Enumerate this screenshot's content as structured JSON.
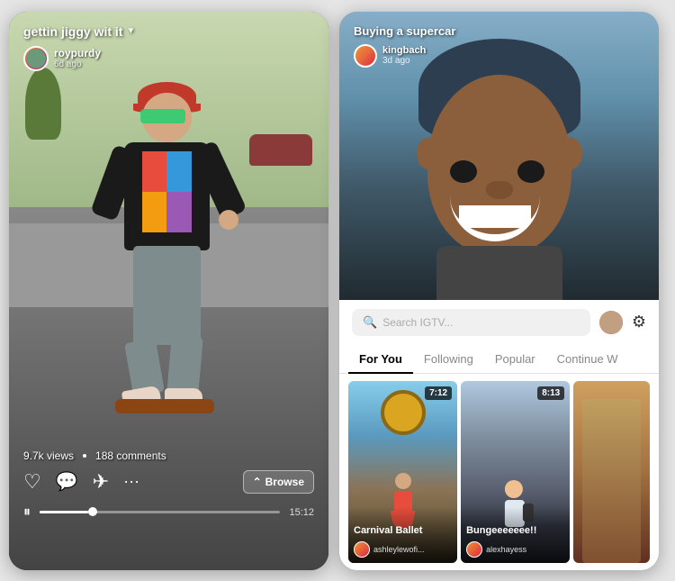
{
  "left_phone": {
    "title": "gettin jiggy wit it",
    "title_chevron": "▼",
    "creator": {
      "name": "roypurdy",
      "time": "6d ago"
    },
    "stats": {
      "views": "9.7k views",
      "comments": "188 comments"
    },
    "actions": {
      "browse_label": "Browse"
    },
    "progress": {
      "time": "15:12"
    }
  },
  "right_phone": {
    "video_title": "Buying a supercar",
    "creator": {
      "name": "kingbach",
      "time": "3d ago"
    },
    "search_placeholder": "Search IGTV...",
    "tabs": [
      {
        "label": "For You",
        "active": true
      },
      {
        "label": "Following",
        "active": false
      },
      {
        "label": "Popular",
        "active": false
      },
      {
        "label": "Continue W",
        "active": false
      }
    ],
    "thumbnails": [
      {
        "title": "Carnival Ballet",
        "creator": "ashleylewofi...",
        "duration": "7:12"
      },
      {
        "title": "Bungeeeeeee!!",
        "creator": "alexhayess",
        "duration": "8:13"
      },
      {
        "title": "",
        "creator": "",
        "duration": ""
      }
    ]
  }
}
